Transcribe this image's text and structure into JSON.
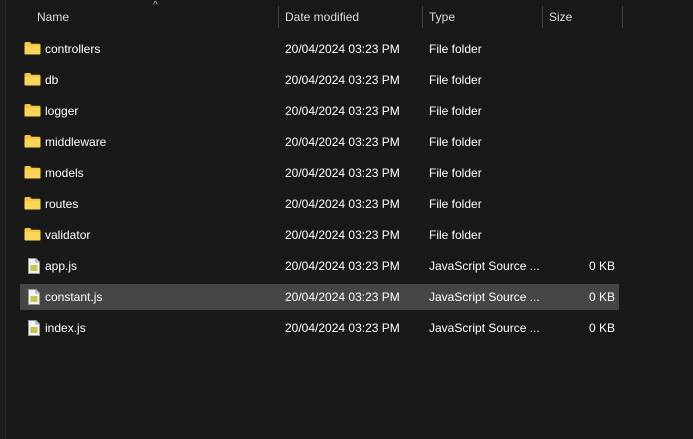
{
  "columns": {
    "name": "Name",
    "date_modified": "Date modified",
    "type": "Type",
    "size": "Size"
  },
  "sort_indicator": "^",
  "files": [
    {
      "name": "controllers",
      "date": "20/04/2024 03:23 PM",
      "type": "File folder",
      "size": "",
      "icon": "folder-icon"
    },
    {
      "name": "db",
      "date": "20/04/2024 03:23 PM",
      "type": "File folder",
      "size": "",
      "icon": "folder-icon"
    },
    {
      "name": "logger",
      "date": "20/04/2024 03:23 PM",
      "type": "File folder",
      "size": "",
      "icon": "folder-icon"
    },
    {
      "name": "middleware",
      "date": "20/04/2024 03:23 PM",
      "type": "File folder",
      "size": "",
      "icon": "folder-icon"
    },
    {
      "name": "models",
      "date": "20/04/2024 03:23 PM",
      "type": "File folder",
      "size": "",
      "icon": "folder-icon"
    },
    {
      "name": "routes",
      "date": "20/04/2024 03:23 PM",
      "type": "File folder",
      "size": "",
      "icon": "folder-icon"
    },
    {
      "name": "validator",
      "date": "20/04/2024 03:23 PM",
      "type": "File folder",
      "size": "",
      "icon": "folder-icon"
    },
    {
      "name": "app.js",
      "date": "20/04/2024 03:23 PM",
      "type": "JavaScript Source ...",
      "size": "0 KB",
      "icon": "js-file-icon"
    },
    {
      "name": "constant.js",
      "date": "20/04/2024 03:23 PM",
      "type": "JavaScript Source ...",
      "size": "0 KB",
      "icon": "js-file-icon",
      "selected": true
    },
    {
      "name": "index.js",
      "date": "20/04/2024 03:23 PM",
      "type": "JavaScript Source ...",
      "size": "0 KB",
      "icon": "js-file-icon"
    }
  ],
  "colors": {
    "background": "#191919",
    "selected_row": "#464646",
    "folder": "#f4c542",
    "js_badge": "#c9c44a"
  }
}
